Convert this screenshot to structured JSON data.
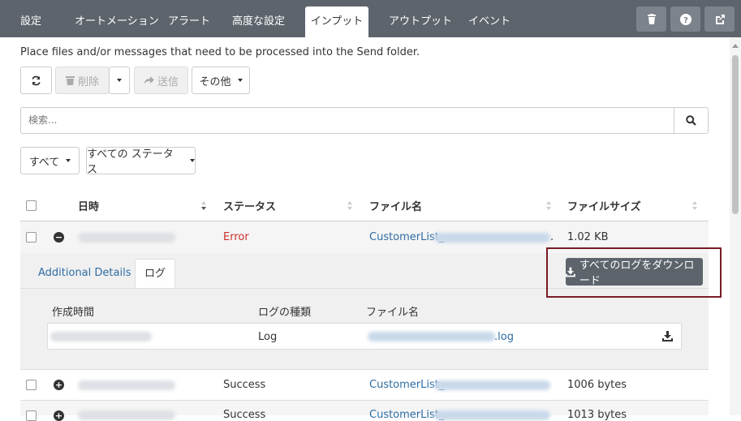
{
  "tabs": [
    {
      "label": "設定"
    },
    {
      "label": "オートメーション"
    },
    {
      "label": "アラート"
    },
    {
      "label": "高度な設定"
    },
    {
      "label": "インプット"
    },
    {
      "label": "アウトプット"
    },
    {
      "label": "イベント"
    }
  ],
  "description": "Place files and/or messages that need to be processed into the  Send folder.",
  "toolbar": {
    "delete_label": "削除",
    "send_label": "送信",
    "other_label": "その他"
  },
  "search": {
    "placeholder": "検索..."
  },
  "filters": {
    "all_label": "すべて",
    "status_label": "すべての ステータス"
  },
  "table": {
    "headers": {
      "date": "日時",
      "status": "ステータス",
      "filename": "ファイル名",
      "filesize": "ファイルサイズ"
    },
    "rows": [
      {
        "status": "Error",
        "filename_prefix": "CustomerList_",
        "size": "1.02 KB",
        "expanded": true
      },
      {
        "status": "Success",
        "filename_prefix": "CustomerList_",
        "size": "1006 bytes",
        "expanded": false
      },
      {
        "status": "Success",
        "filename_prefix": "CustomerList_",
        "size": "1013 bytes",
        "expanded": false
      }
    ]
  },
  "detail": {
    "tab_additional": "Additional Details",
    "tab_log": "ログ",
    "download_all_label": "すべてのログをダウンロード",
    "log_headers": {
      "created": "作成時間",
      "type": "ログの種類",
      "filename": "ファイル名"
    },
    "log_row": {
      "type": "Log",
      "ext": ".log"
    }
  },
  "colors": {
    "topbar": "#5d646c",
    "error": "#c9302c",
    "link": "#2e6da4",
    "highlight_border": "#7a1a24"
  }
}
